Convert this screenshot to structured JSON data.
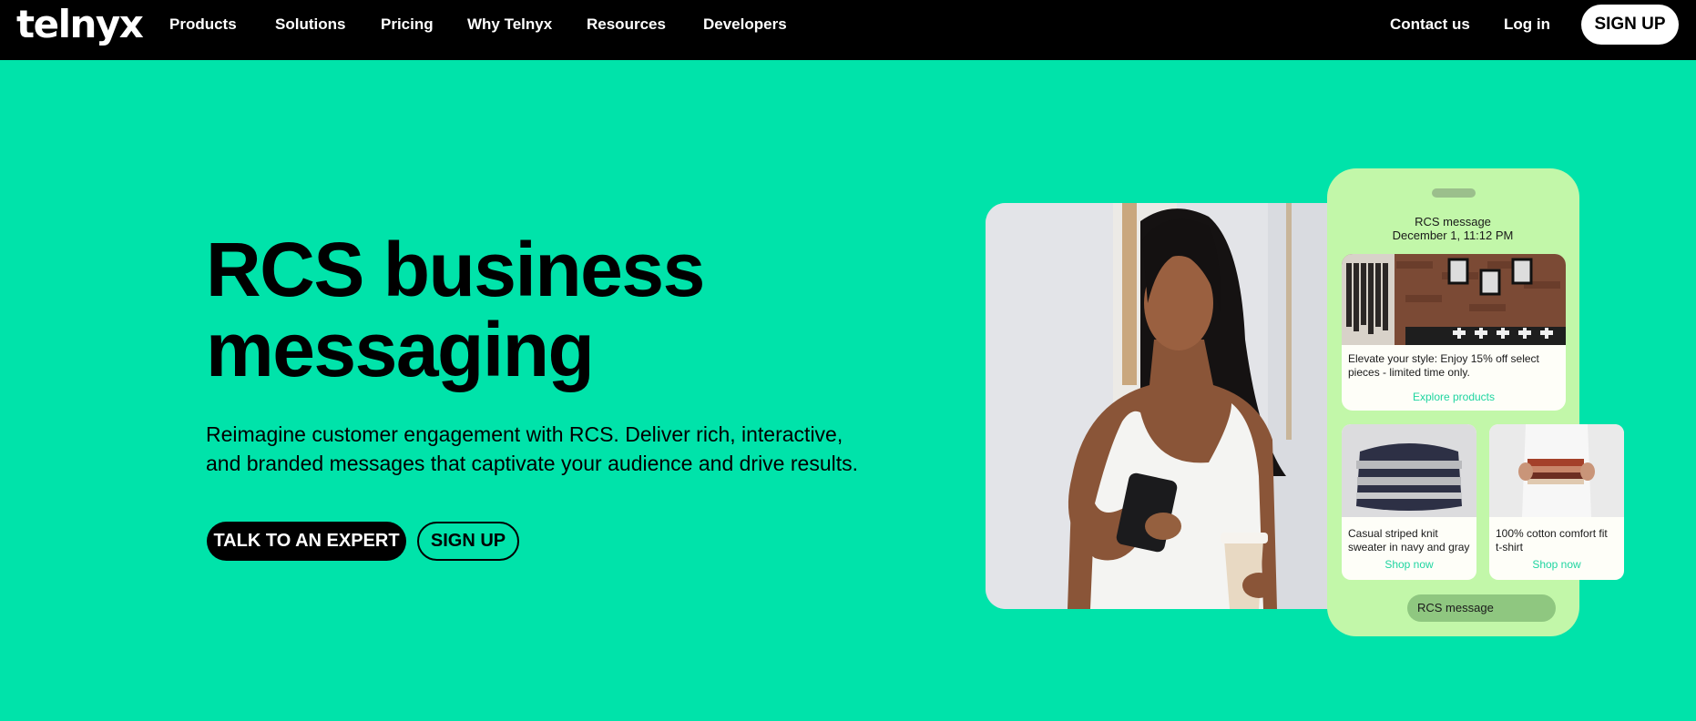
{
  "brand": {
    "logo_text": "telnyx"
  },
  "nav": {
    "items": [
      "Products",
      "Solutions",
      "Pricing",
      "Why Telnyx",
      "Resources",
      "Developers"
    ],
    "contact": "Contact us",
    "login": "Log in",
    "signup": "SIGN UP"
  },
  "hero": {
    "title_line1": "RCS business",
    "title_line2": "messaging",
    "desc_line1": "Reimagine customer engagement with RCS. Deliver rich, interactive,",
    "desc_line2": "and branded messages that captivate your audience and drive results.",
    "cta_primary": "TALK TO AN EXPERT",
    "cta_secondary": "SIGN UP"
  },
  "phone": {
    "header_title": "RCS message",
    "header_date": "December 1, 11:12 PM",
    "main_card": {
      "text_line1": "Elevate your style: Enjoy 15% off select",
      "text_line2": "pieces - limited time only.",
      "link": "Explore products"
    },
    "card_left": {
      "text_line1": "Casual striped knit",
      "text_line2": "sweater in navy and gray",
      "link": "Shop now"
    },
    "card_right": {
      "text_line1": "100% cotton comfort fit",
      "text_line2": "t-shirt",
      "link": "Shop now"
    },
    "input_placeholder": "RCS message"
  },
  "colors": {
    "background": "#00E3AA",
    "nav": "#000000",
    "phone": "#C2F7A9",
    "link": "#1FD5A0"
  }
}
